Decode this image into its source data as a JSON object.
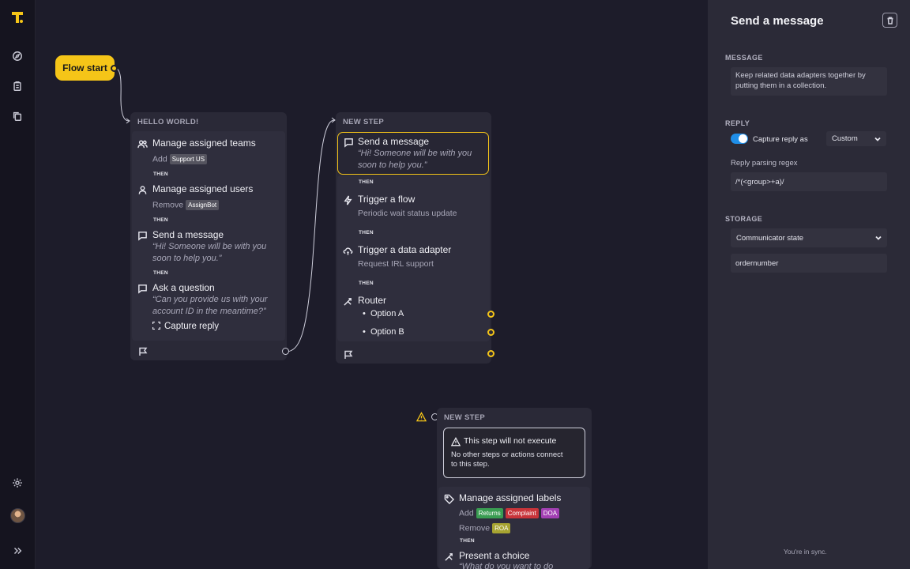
{
  "canvas": {
    "flow_start_label": "Flow start",
    "step1": {
      "title": "HELLO WORLD!",
      "actions": [
        {
          "title": "Manage assigned teams",
          "verb": "Add",
          "tag": "Support US"
        },
        {
          "title": "Manage assigned users",
          "verb": "Remove",
          "tag": "AssignBot"
        },
        {
          "title": "Send a message",
          "quote_line1": "“Hi! Someone will be with you",
          "quote_line2": "soon to help you.”"
        },
        {
          "title": "Ask a question",
          "quote_line1": "“Can you provide us with your",
          "quote_line2": "account ID in the meantime?”",
          "capture": "Capture reply"
        }
      ],
      "then": "THEN"
    },
    "step2": {
      "title": "NEW STEP",
      "send": {
        "title": "Send a message",
        "quote_line1": "“Hi! Someone will be with you",
        "quote_line2": "soon to help you.”"
      },
      "trigger_flow": {
        "title": "Trigger a flow",
        "sub": "Periodic wait status update"
      },
      "trigger_adapter": {
        "title": "Trigger a data adapter",
        "sub": "Request IRL support"
      },
      "router": {
        "title": "Router",
        "options": [
          "Option A",
          "Option B"
        ]
      },
      "then": "THEN"
    },
    "step3": {
      "title": "NEW STEP",
      "warning_title": "This step will not execute",
      "warning_line1": "No other steps or actions connect",
      "warning_line2": "to this step.",
      "labels": {
        "title": "Manage assigned labels",
        "add_verb": "Add",
        "add_tags": [
          "Returns",
          "Complaint",
          "DOA"
        ],
        "remove_verb": "Remove",
        "remove_tags": [
          "ROA"
        ]
      },
      "then": "THEN",
      "choice": {
        "title": "Present a choice",
        "quote_line1": "“What do you want to do"
      }
    }
  },
  "panel": {
    "title": "Send a message",
    "message_label": "MESSAGE",
    "message_text_line1": "Keep related data adapters together by",
    "message_text_line2": "putting them in a collection.",
    "reply_label": "REPLY",
    "capture_reply_as": "Capture reply as",
    "capture_type": "Custom",
    "regex_label": "Reply parsing regex",
    "regex_value": "/*(<group>+a)/",
    "storage_label": "STORAGE",
    "storage_select": "Communicator state",
    "storage_key": "ordernumber",
    "sync_status": "You're in sync."
  },
  "colors": {
    "accent": "#f5c518",
    "toggle_on": "#1f8ee8",
    "tag_grey": "#55545f",
    "tag_green": "#3a9d52",
    "tag_red": "#c9343a",
    "tag_purple": "#a23fb3",
    "tag_olive": "#a7a431"
  }
}
